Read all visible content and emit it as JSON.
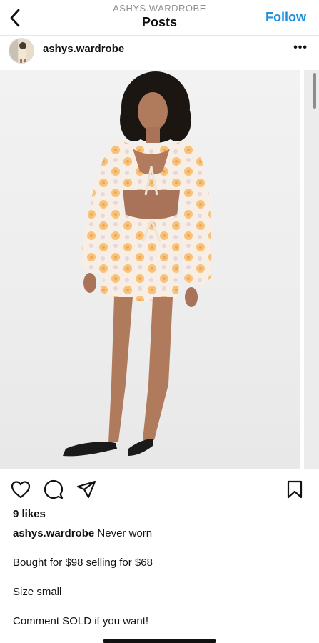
{
  "nav": {
    "subtitle": "ASHYS.WARDROBE",
    "title": "Posts",
    "follow_label": "Follow",
    "back_icon": "chevron-left-icon"
  },
  "post": {
    "username": "ashys.wardrobe",
    "more_icon": "more-dots-icon",
    "more_label": "•••",
    "image_description": "Model wearing a white and orange floral long-sleeve cutout mini dress with black sandals",
    "carousel_position": 1
  },
  "actions": {
    "like_icon": "heart-icon",
    "comment_icon": "comment-icon",
    "share_icon": "share-icon",
    "save_icon": "bookmark-icon"
  },
  "stats": {
    "likes": "9 likes"
  },
  "caption": {
    "username": "ashys.wardrobe",
    "line1": "Never worn",
    "line2": "Bought for $98 selling for $68",
    "line3": "Size small",
    "line4": "Comment SOLD if you want!"
  },
  "colors": {
    "accent": "#1f8fe0",
    "text": "#111111",
    "secondary": "#8e8e8e"
  }
}
